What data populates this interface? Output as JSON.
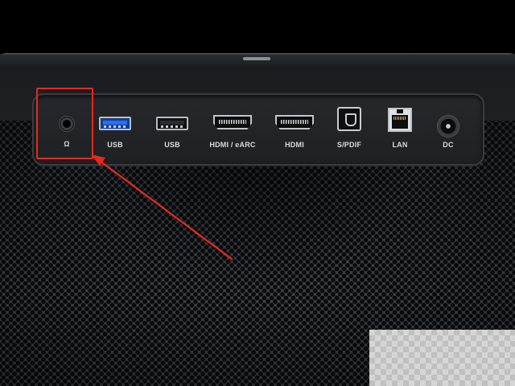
{
  "ports": [
    {
      "id": "headphone",
      "label": "Ω",
      "kind": "jack"
    },
    {
      "id": "usb1",
      "label": "USB",
      "kind": "usb-blue"
    },
    {
      "id": "usb2",
      "label": "USB",
      "kind": "usb-black"
    },
    {
      "id": "hdmi-earc",
      "label": "HDMI / eARC",
      "kind": "hdmi"
    },
    {
      "id": "hdmi",
      "label": "HDMI",
      "kind": "hdmi"
    },
    {
      "id": "spdif",
      "label": "S/PDIF",
      "kind": "optical"
    },
    {
      "id": "lan",
      "label": "LAN",
      "kind": "ethernet"
    },
    {
      "id": "dc",
      "label": "DC",
      "kind": "dc-power"
    }
  ],
  "annotation": {
    "highlighted_port": "headphone",
    "color": "#e8281f"
  },
  "colors": {
    "panel": "#1e2023",
    "port_label": "#d9dadd",
    "usb3_blue": "#2f6cf0"
  },
  "icons": [
    "headphone-jack-icon",
    "usb-port-icon",
    "hdmi-port-icon",
    "optical-port-icon",
    "ethernet-port-icon",
    "dc-jack-icon"
  ]
}
